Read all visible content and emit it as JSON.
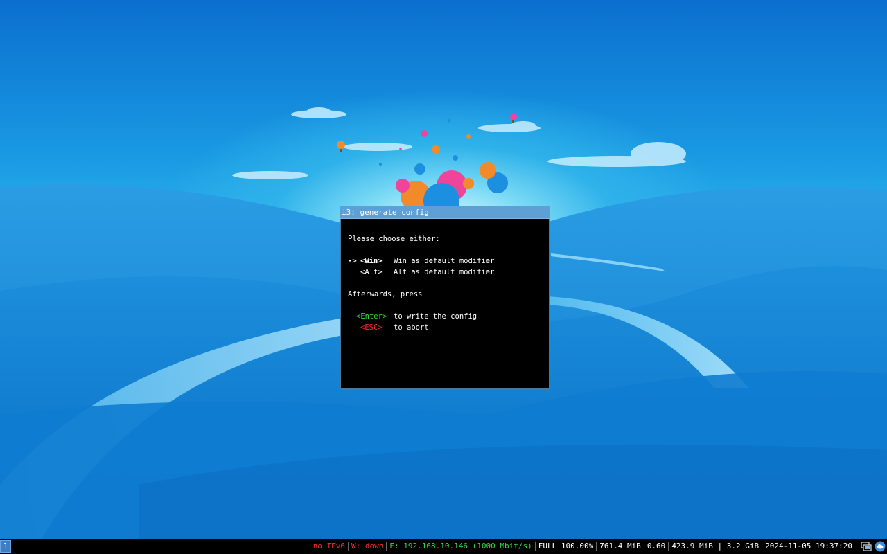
{
  "window": {
    "title": "i3: generate config",
    "lines": {
      "prompt": "Please choose either:",
      "win_arrow": "->",
      "win_key": "<Win>",
      "win_desc": "Win as default modifier",
      "alt_key": "<Alt>",
      "alt_desc": "Alt as default modifier",
      "afterwards": "Afterwards, press",
      "enter_key": "<Enter>",
      "enter_desc": "to write the config",
      "esc_key": "<ESC>",
      "esc_desc": "to abort"
    }
  },
  "bar": {
    "workspace": "1",
    "status": {
      "ipv6": "no IPv6",
      "wireless": "W: down",
      "ethernet": "E: 192.168.10.146 (1000 Mbit/s)",
      "battery": "FULL 100.00%",
      "disk": "761.4 MiB",
      "load": "0.60",
      "memory": "423.9 MiB | 3.2 GiB",
      "datetime": "2024-11-05 19:37:20"
    },
    "colors": {
      "ipv6": "#ff2a2a",
      "wireless": "#ff2a2a",
      "ethernet": "#33d94a",
      "default": "#ffffff"
    },
    "tray_icons": [
      "network-manager-icon",
      "cloud-sync-icon"
    ]
  },
  "colors": {
    "titlebar": "#5e9fd6",
    "window_bg": "#000000",
    "green": "#33d94a",
    "red": "#ff2a2a"
  }
}
